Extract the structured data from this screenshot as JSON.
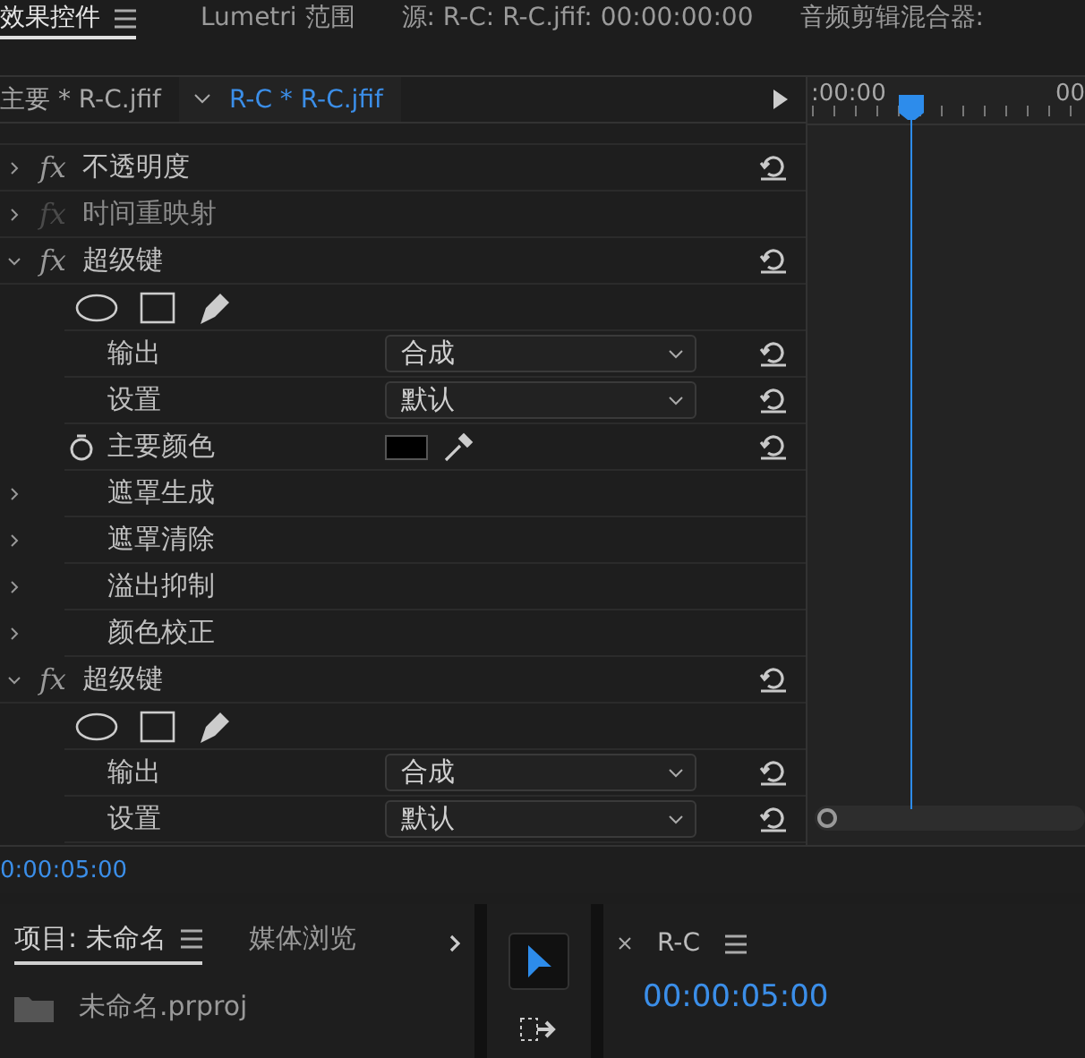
{
  "tabs": [
    {
      "label": "效果控件",
      "selected": true
    },
    {
      "label": "Lumetri 范围",
      "selected": false
    },
    {
      "label": "源: R-C: R-C.jfif: 00:00:00:00",
      "selected": false
    },
    {
      "label": "音频剪辑混合器:",
      "selected": false
    }
  ],
  "clip_tabs": [
    {
      "label": "主要 * R-C.jfif",
      "selected": false
    },
    {
      "label": "R-C * R-C.jfif",
      "selected": true
    }
  ],
  "ruler": {
    "start": ":00:00",
    "next": "00"
  },
  "effects": [
    {
      "mark": "fx",
      "label": "不透明度",
      "expanded": false,
      "disabled": false,
      "reset": true
    },
    {
      "mark": "fx",
      "label": "时间重映射",
      "expanded": false,
      "disabled": true,
      "reset": false
    },
    {
      "mark": "fx",
      "label": "超级键",
      "expanded": true,
      "disabled": false,
      "reset": true,
      "children": [
        {
          "kind": "shapes"
        },
        {
          "kind": "dropdown",
          "label": "输出",
          "value": "合成"
        },
        {
          "kind": "dropdown",
          "label": "设置",
          "value": "默认"
        },
        {
          "kind": "color",
          "label": "主要颜色",
          "color": "#000000"
        },
        {
          "kind": "group",
          "label": "遮罩生成"
        },
        {
          "kind": "group",
          "label": "遮罩清除"
        },
        {
          "kind": "group",
          "label": "溢出抑制"
        },
        {
          "kind": "group",
          "label": "颜色校正"
        }
      ]
    },
    {
      "mark": "fx",
      "label": "超级键",
      "expanded": true,
      "disabled": false,
      "reset": true,
      "children": [
        {
          "kind": "shapes"
        },
        {
          "kind": "dropdown",
          "label": "输出",
          "value": "合成"
        },
        {
          "kind": "dropdown",
          "label": "设置",
          "value": "默认"
        }
      ]
    }
  ],
  "current_time": "0:00:05:00",
  "project": {
    "tabs": [
      {
        "label": "项目: 未命名",
        "selected": true
      },
      {
        "label": "媒体浏览",
        "selected": false
      }
    ],
    "file": "未命名.prproj"
  },
  "tools": [
    {
      "kind": "select",
      "selected": true
    },
    {
      "kind": "track-select",
      "selected": false
    }
  ],
  "program": {
    "title": "R-C",
    "timecode": "00:00:05:00"
  }
}
